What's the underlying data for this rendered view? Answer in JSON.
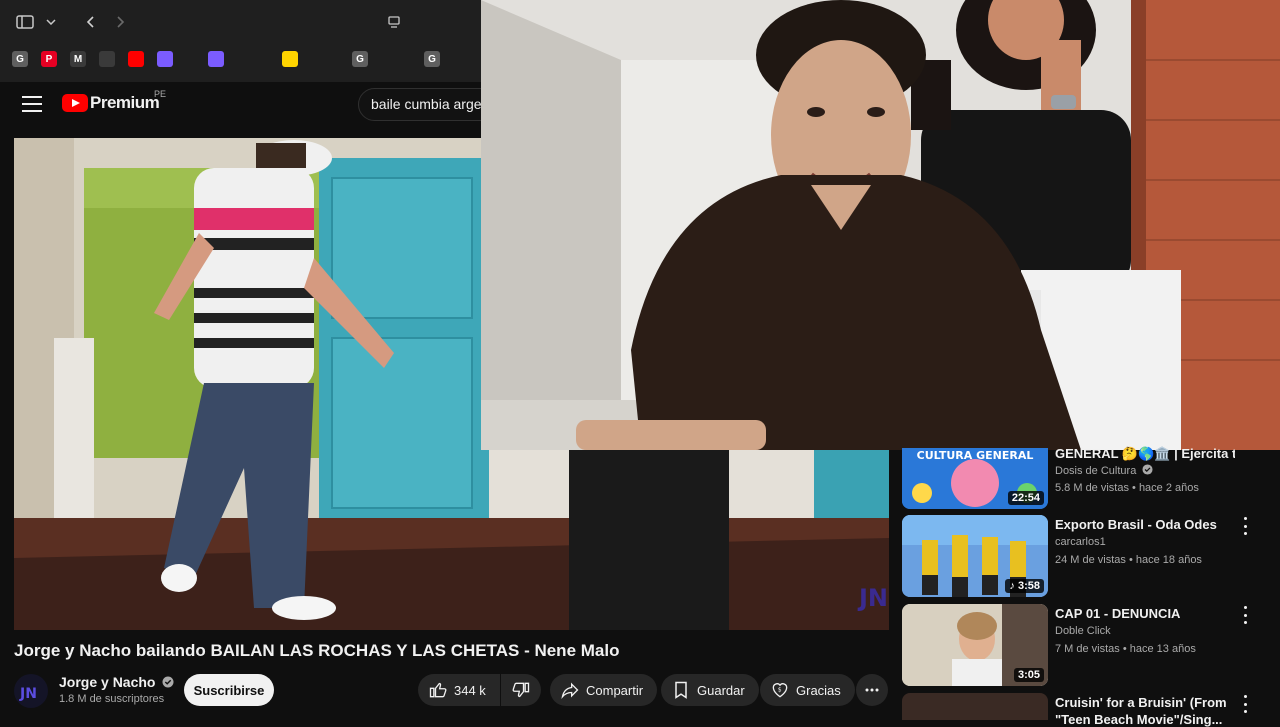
{
  "browser": {
    "tabs": [
      {
        "icon": "google-g-icon",
        "glyph": "G",
        "color": "#5f5f5f"
      },
      {
        "icon": "pinterest-icon",
        "glyph": "P",
        "color": "#e60023"
      },
      {
        "icon": "gmail-icon",
        "glyph": "M",
        "color": "#3a3a3a"
      },
      {
        "icon": "headphones-icon",
        "glyph": "",
        "color": "#3a3a3a"
      },
      {
        "icon": "youtube-icon",
        "glyph": "",
        "color": "#ff0000"
      },
      {
        "icon": "tab-app-icon",
        "glyph": "",
        "color": "#7b5cff"
      },
      {
        "icon": "tab-app-icon",
        "glyph": "",
        "color": "#7b5cff"
      },
      {
        "icon": "yellow-tab-icon",
        "glyph": "",
        "color": "#ffd400"
      },
      {
        "icon": "google-g-icon",
        "glyph": "G",
        "color": "#5f5f5f"
      },
      {
        "icon": "google-g-icon",
        "glyph": "G",
        "color": "#5f5f5f"
      }
    ]
  },
  "header": {
    "logo_text": "Premium",
    "country": "PE",
    "search_value": "baile cumbia arge"
  },
  "video": {
    "title": "Jorge y Nacho bailando BAILAN LAS ROCHAS Y LAS CHETAS - Nene Malo",
    "watermark": "JN"
  },
  "channel": {
    "name": "Jorge y Nacho",
    "subs": "1.8 M de suscriptores",
    "avatar_text": "JN",
    "subscribe_label": "Suscribirse"
  },
  "actions": {
    "likes": "344 k",
    "share": "Compartir",
    "save": "Guardar",
    "thanks": "Gracias"
  },
  "recommendations": [
    {
      "title": "GENERAL 🤔🌎🏛️ | Ejercita t...",
      "channel": "Dosis de Cultura",
      "verified": true,
      "meta": "5.8 M de vistas • hace 2 años",
      "duration": "22:54",
      "thumb_text": "CULTURA GENERAL"
    },
    {
      "title": "Exporto Brasil - Oda Odes",
      "channel": "carcarlos1",
      "verified": false,
      "meta": "24 M de vistas • hace 18 años",
      "duration": "3:58",
      "thumb_text": ""
    },
    {
      "title": "CAP 01 - DENUNCIA",
      "channel": "Doble Click",
      "verified": false,
      "meta": "7 M de vistas • hace 13 años",
      "duration": "3:05",
      "thumb_text": ""
    },
    {
      "title": "Cruisin' for a Bruisin' (From",
      "title2": "\"Teen Beach Movie\"/Sing...",
      "channel": "",
      "verified": false,
      "meta": "",
      "duration": "",
      "thumb_text": ""
    }
  ],
  "colors": {
    "background": "#0f0f0f",
    "accent": "#ff0000",
    "pill": "#272727"
  }
}
